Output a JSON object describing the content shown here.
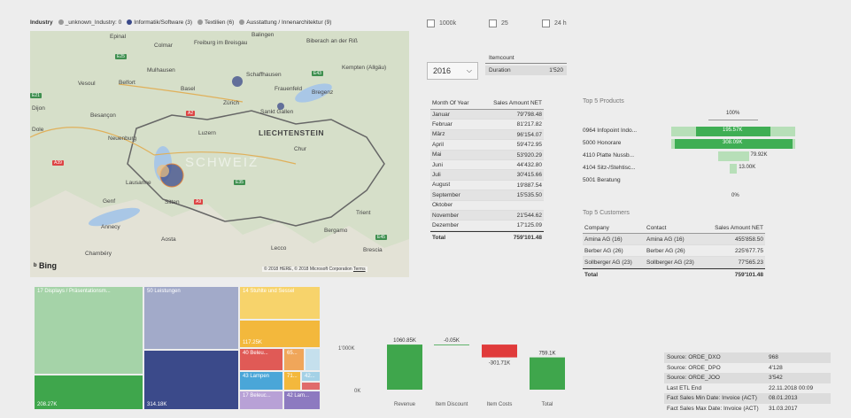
{
  "legend": {
    "title": "Industry",
    "items": [
      {
        "label": "_unknown_Industry: 0",
        "color": "#999999"
      },
      {
        "label": "Informatik/Software (3)",
        "color": "#3b4a8a"
      },
      {
        "label": "Textilien (6)",
        "color": "#999999"
      },
      {
        "label": "Ausstattung / Innenarchitektur (9)",
        "color": "#999999"
      }
    ]
  },
  "map": {
    "country_label": "LIECHTENSTEIN",
    "watermark": "SCHWEIZ",
    "logo": "Bing",
    "copyright": "© 2018 HERE, © 2018 Microsoft Corporation",
    "terms": "Terms",
    "places": [
      "Epinal",
      "Colmar",
      "Freiburg im Breisgau",
      "Balingen",
      "Biberach an der Riß",
      "Kempten (Allgäu)",
      "Mulhausen",
      "Schaffhausen",
      "Frauenfeld",
      "Vesoul",
      "Belfort",
      "Basel",
      "Zürich",
      "Bregenz",
      "Besançon",
      "Sankt Gallen",
      "Dijon",
      "Dole",
      "Neuenburg",
      "Luzern",
      "Chur",
      "Lausanne",
      "Genf",
      "Sitten",
      "Annecy",
      "Aosta",
      "Bergamo",
      "Brescia",
      "Trient",
      "Lecco",
      "Chambéry"
    ]
  },
  "toggles": [
    {
      "label": "1000k"
    },
    {
      "label": "25"
    },
    {
      "label": "24 h"
    }
  ],
  "year_select": {
    "value": "2016"
  },
  "remcount": {
    "header": "Itemcount",
    "label": "Duration",
    "value": "1'520"
  },
  "month_table": {
    "headers": [
      "Month Of Year",
      "Sales Amount NET"
    ],
    "rows": [
      {
        "month": "Januar",
        "value": "79'798.48",
        "frac": 0.77
      },
      {
        "month": "Februar",
        "value": "81'217.82",
        "frac": 0.78
      },
      {
        "month": "März",
        "value": "96'154.07",
        "frac": 0.92
      },
      {
        "month": "April",
        "value": "59'472.95",
        "frac": 0.57
      },
      {
        "month": "Mai",
        "value": "53'920.29",
        "frac": 0.52
      },
      {
        "month": "Juni",
        "value": "44'432.80",
        "frac": 0.43
      },
      {
        "month": "Juli",
        "value": "30'415.66",
        "frac": 0.29
      },
      {
        "month": "August",
        "value": "19'887.54",
        "frac": 0.19
      },
      {
        "month": "September",
        "value": "15'535.50",
        "frac": 0.15
      },
      {
        "month": "Oktober",
        "value": "",
        "frac": 1.0
      },
      {
        "month": "November",
        "value": "21'544.62",
        "frac": 0.21
      },
      {
        "month": "Dezember",
        "value": "17'125.09",
        "frac": 0.16
      }
    ],
    "total_label": "Total",
    "total_value": "759'101.48"
  },
  "top_products": {
    "title": "Top 5 Products",
    "scale_top": "100%",
    "scale_bottom": "0%",
    "rows": [
      {
        "label": "0964 Infopoint Indo...",
        "value": "195.57K",
        "frac": 0.6
      },
      {
        "label": "5000 Honorare",
        "value": "308.09K",
        "frac": 0.95
      },
      {
        "label": "4110 Platte Nussb...",
        "value": "79.92K",
        "frac": 0.25
      },
      {
        "label": "4104 Sitz-/Stehtisc...",
        "value": "13.00K",
        "frac": 0.06
      },
      {
        "label": "5001 Beratung",
        "value": "",
        "frac": 0.0
      }
    ]
  },
  "top_customers": {
    "title": "Top 5 Customers",
    "headers": [
      "Company",
      "Contact",
      "Sales Amount NET"
    ],
    "rows": [
      [
        "Amina AG (16)",
        "Amina AG (16)",
        "455'858.50"
      ],
      [
        "Berber AG (26)",
        "Berber AG (26)",
        "225'677.75"
      ],
      [
        "Sollberger AG (23)",
        "Sollberger AG (23)",
        "77'565.23"
      ]
    ],
    "total_label": "Total",
    "total_value": "759'101.48"
  },
  "treemap": {
    "tiles": [
      {
        "label": "17 Displays / Präsentationsm...",
        "value": "",
        "color": "#a5d3a8"
      },
      {
        "label": "",
        "value": "208.27K",
        "color": "#3fa64c"
      },
      {
        "label": "50 Leistungen",
        "value": "",
        "color": "#a2aac9"
      },
      {
        "label": "",
        "value": "314.18K",
        "color": "#3b4a8a"
      },
      {
        "label": "14 Stuhlte und Sessel",
        "value": "",
        "color": "#f7d36b"
      },
      {
        "label": "",
        "value": "117.25K",
        "color": "#f3b83c"
      },
      {
        "label": "40 Beleu...",
        "value": "",
        "color": "#e05a56"
      },
      {
        "label": "65...",
        "value": "",
        "color": "#f0a65a"
      },
      {
        "label": "43 Lampen",
        "value": "",
        "color": "#4aa6d8"
      },
      {
        "label": "71...",
        "value": "",
        "color": "#f3b83c"
      },
      {
        "label": "42...",
        "value": "",
        "color": "#a4d1e6"
      },
      {
        "label": "17 Beleuc...",
        "value": "",
        "color": "#b8a1d6"
      },
      {
        "label": "42 Lam...",
        "value": "",
        "color": "#8d7ac0"
      }
    ]
  },
  "waterfall": {
    "y_ticks": [
      "1'000K",
      "0K"
    ],
    "bars": [
      {
        "label": "Revenue",
        "value": "1060.85K",
        "color": "#3fa64c"
      },
      {
        "label": "Item Discount",
        "value": "-0.05K",
        "color": "#3fa64c"
      },
      {
        "label": "Item Costs",
        "value": "-301.71K",
        "color": "#e03b3b"
      },
      {
        "label": "Total",
        "value": "759.1K",
        "color": "#3fa64c"
      }
    ]
  },
  "info_table": {
    "rows": [
      [
        "Source: ORDE_DXO",
        "968"
      ],
      [
        "Source: ORDE_DPO",
        "4'128"
      ],
      [
        "Source: ORDE_JOO",
        "3'542"
      ],
      [
        "Last ETL End",
        "22.11.2018 00:09"
      ],
      [
        "Fact Sales Min Date: Invoice (ACT)",
        "08.01.2013"
      ],
      [
        "Fact Sales Max Date: Invoice (ACT)",
        "31.03.2017"
      ]
    ]
  }
}
